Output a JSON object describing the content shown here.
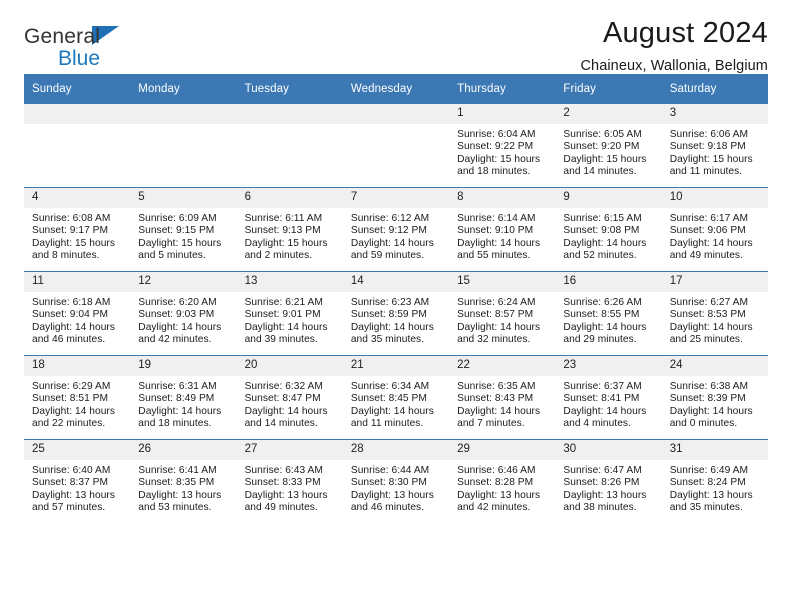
{
  "brand": {
    "line1": "General",
    "line2": "Blue",
    "triangle_color": "#1f6fb4",
    "text_color": "#333333",
    "accent_color": "#1f78bd"
  },
  "header": {
    "title": "August 2024",
    "subtitle": "Chaineux, Wallonia, Belgium"
  },
  "theme": {
    "header_bg": "#3b78b4",
    "daynum_bg": "#f0f0f0",
    "text": "#1c1c1c"
  },
  "labels": {
    "sunrise_prefix": "Sunrise:",
    "sunset_prefix": "Sunset:",
    "daylight_prefix": "Daylight:"
  },
  "weekdays": [
    "Sunday",
    "Monday",
    "Tuesday",
    "Wednesday",
    "Thursday",
    "Friday",
    "Saturday"
  ],
  "weeks": [
    [
      {
        "day": "",
        "empty": true
      },
      {
        "day": "",
        "empty": true
      },
      {
        "day": "",
        "empty": true
      },
      {
        "day": "",
        "empty": true
      },
      {
        "day": "1",
        "sunrise": "Sunrise: 6:04 AM",
        "sunset": "Sunset: 9:22 PM",
        "daylight": "Daylight: 15 hours and 18 minutes."
      },
      {
        "day": "2",
        "sunrise": "Sunrise: 6:05 AM",
        "sunset": "Sunset: 9:20 PM",
        "daylight": "Daylight: 15 hours and 14 minutes."
      },
      {
        "day": "3",
        "sunrise": "Sunrise: 6:06 AM",
        "sunset": "Sunset: 9:18 PM",
        "daylight": "Daylight: 15 hours and 11 minutes."
      }
    ],
    [
      {
        "day": "4",
        "sunrise": "Sunrise: 6:08 AM",
        "sunset": "Sunset: 9:17 PM",
        "daylight": "Daylight: 15 hours and 8 minutes."
      },
      {
        "day": "5",
        "sunrise": "Sunrise: 6:09 AM",
        "sunset": "Sunset: 9:15 PM",
        "daylight": "Daylight: 15 hours and 5 minutes."
      },
      {
        "day": "6",
        "sunrise": "Sunrise: 6:11 AM",
        "sunset": "Sunset: 9:13 PM",
        "daylight": "Daylight: 15 hours and 2 minutes."
      },
      {
        "day": "7",
        "sunrise": "Sunrise: 6:12 AM",
        "sunset": "Sunset: 9:12 PM",
        "daylight": "Daylight: 14 hours and 59 minutes."
      },
      {
        "day": "8",
        "sunrise": "Sunrise: 6:14 AM",
        "sunset": "Sunset: 9:10 PM",
        "daylight": "Daylight: 14 hours and 55 minutes."
      },
      {
        "day": "9",
        "sunrise": "Sunrise: 6:15 AM",
        "sunset": "Sunset: 9:08 PM",
        "daylight": "Daylight: 14 hours and 52 minutes."
      },
      {
        "day": "10",
        "sunrise": "Sunrise: 6:17 AM",
        "sunset": "Sunset: 9:06 PM",
        "daylight": "Daylight: 14 hours and 49 minutes."
      }
    ],
    [
      {
        "day": "11",
        "sunrise": "Sunrise: 6:18 AM",
        "sunset": "Sunset: 9:04 PM",
        "daylight": "Daylight: 14 hours and 46 minutes."
      },
      {
        "day": "12",
        "sunrise": "Sunrise: 6:20 AM",
        "sunset": "Sunset: 9:03 PM",
        "daylight": "Daylight: 14 hours and 42 minutes."
      },
      {
        "day": "13",
        "sunrise": "Sunrise: 6:21 AM",
        "sunset": "Sunset: 9:01 PM",
        "daylight": "Daylight: 14 hours and 39 minutes."
      },
      {
        "day": "14",
        "sunrise": "Sunrise: 6:23 AM",
        "sunset": "Sunset: 8:59 PM",
        "daylight": "Daylight: 14 hours and 35 minutes."
      },
      {
        "day": "15",
        "sunrise": "Sunrise: 6:24 AM",
        "sunset": "Sunset: 8:57 PM",
        "daylight": "Daylight: 14 hours and 32 minutes."
      },
      {
        "day": "16",
        "sunrise": "Sunrise: 6:26 AM",
        "sunset": "Sunset: 8:55 PM",
        "daylight": "Daylight: 14 hours and 29 minutes."
      },
      {
        "day": "17",
        "sunrise": "Sunrise: 6:27 AM",
        "sunset": "Sunset: 8:53 PM",
        "daylight": "Daylight: 14 hours and 25 minutes."
      }
    ],
    [
      {
        "day": "18",
        "sunrise": "Sunrise: 6:29 AM",
        "sunset": "Sunset: 8:51 PM",
        "daylight": "Daylight: 14 hours and 22 minutes."
      },
      {
        "day": "19",
        "sunrise": "Sunrise: 6:31 AM",
        "sunset": "Sunset: 8:49 PM",
        "daylight": "Daylight: 14 hours and 18 minutes."
      },
      {
        "day": "20",
        "sunrise": "Sunrise: 6:32 AM",
        "sunset": "Sunset: 8:47 PM",
        "daylight": "Daylight: 14 hours and 14 minutes."
      },
      {
        "day": "21",
        "sunrise": "Sunrise: 6:34 AM",
        "sunset": "Sunset: 8:45 PM",
        "daylight": "Daylight: 14 hours and 11 minutes."
      },
      {
        "day": "22",
        "sunrise": "Sunrise: 6:35 AM",
        "sunset": "Sunset: 8:43 PM",
        "daylight": "Daylight: 14 hours and 7 minutes."
      },
      {
        "day": "23",
        "sunrise": "Sunrise: 6:37 AM",
        "sunset": "Sunset: 8:41 PM",
        "daylight": "Daylight: 14 hours and 4 minutes."
      },
      {
        "day": "24",
        "sunrise": "Sunrise: 6:38 AM",
        "sunset": "Sunset: 8:39 PM",
        "daylight": "Daylight: 14 hours and 0 minutes."
      }
    ],
    [
      {
        "day": "25",
        "sunrise": "Sunrise: 6:40 AM",
        "sunset": "Sunset: 8:37 PM",
        "daylight": "Daylight: 13 hours and 57 minutes."
      },
      {
        "day": "26",
        "sunrise": "Sunrise: 6:41 AM",
        "sunset": "Sunset: 8:35 PM",
        "daylight": "Daylight: 13 hours and 53 minutes."
      },
      {
        "day": "27",
        "sunrise": "Sunrise: 6:43 AM",
        "sunset": "Sunset: 8:33 PM",
        "daylight": "Daylight: 13 hours and 49 minutes."
      },
      {
        "day": "28",
        "sunrise": "Sunrise: 6:44 AM",
        "sunset": "Sunset: 8:30 PM",
        "daylight": "Daylight: 13 hours and 46 minutes."
      },
      {
        "day": "29",
        "sunrise": "Sunrise: 6:46 AM",
        "sunset": "Sunset: 8:28 PM",
        "daylight": "Daylight: 13 hours and 42 minutes."
      },
      {
        "day": "30",
        "sunrise": "Sunrise: 6:47 AM",
        "sunset": "Sunset: 8:26 PM",
        "daylight": "Daylight: 13 hours and 38 minutes."
      },
      {
        "day": "31",
        "sunrise": "Sunrise: 6:49 AM",
        "sunset": "Sunset: 8:24 PM",
        "daylight": "Daylight: 13 hours and 35 minutes."
      }
    ]
  ]
}
